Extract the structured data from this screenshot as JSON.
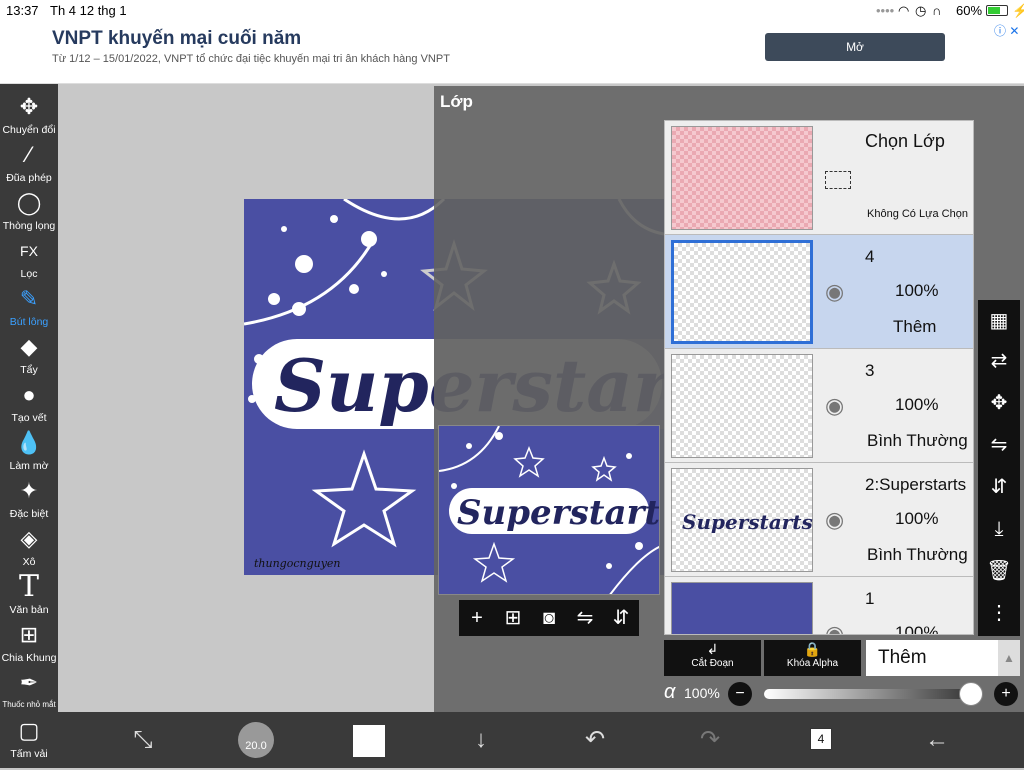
{
  "status": {
    "time": "13:37",
    "date": "Th 4 12 thg 1",
    "battery": "60%"
  },
  "ad": {
    "title": "VNPT khuyến mại cuối năm",
    "subtitle": "Từ 1/12 – 15/01/2022, VNPT tổ chức đại tiệc khuyến mại tri ân khách hàng VNPT",
    "open_label": "Mở",
    "info": "ⓘ ✕"
  },
  "tools": [
    {
      "label": "Chuyển đổi",
      "icon": "move-icon"
    },
    {
      "label": "Đũa phép",
      "icon": "magic-wand-icon"
    },
    {
      "label": "Thòng lọng",
      "icon": "lasso-icon"
    },
    {
      "label": "Lọc",
      "icon": "fx-icon"
    },
    {
      "label": "Bút lông",
      "icon": "brush-icon"
    },
    {
      "label": "Tẩy",
      "icon": "eraser-icon"
    },
    {
      "label": "Tạo vết",
      "icon": "smudge-icon"
    },
    {
      "label": "Làm mờ",
      "icon": "blur-icon"
    },
    {
      "label": "Đặc biệt",
      "icon": "special-icon"
    },
    {
      "label": "Xô",
      "icon": "bucket-icon"
    },
    {
      "label": "Văn bản",
      "icon": "text-icon"
    },
    {
      "label": "Chia Khung",
      "icon": "frame-divider-icon"
    },
    {
      "label": "Thuốc nhỏ mắt",
      "icon": "eyedropper-icon"
    },
    {
      "label": "Tấm vải",
      "icon": "canvas-icon"
    }
  ],
  "active_tool": "Bút lông",
  "artwork": {
    "text": "Superstarts",
    "signature": "thungocnguyen"
  },
  "layer_panel": {
    "title": "Lớp",
    "selection_layer": {
      "name": "Chọn Lớp",
      "status": "Không Có Lựa Chọn"
    },
    "layers": [
      {
        "name": "4",
        "opacity": "100%",
        "mode": "Thêm",
        "selected": true
      },
      {
        "name": "3",
        "opacity": "100%",
        "mode": "Bình Thường",
        "selected": false
      },
      {
        "name": "2:Superstarts",
        "opacity": "100%",
        "mode": "Bình Thường",
        "selected": false
      },
      {
        "name": "1",
        "opacity": "100%",
        "mode": "",
        "selected": false
      }
    ],
    "clip_label": "Cắt Đoạn",
    "alpha_lock_label": "Khóa Alpha",
    "blend_mode": "Thêm",
    "alpha_symbol": "α",
    "alpha_value": "100%"
  },
  "bottom": {
    "brush_size": "20.0",
    "layer_count": "4"
  }
}
